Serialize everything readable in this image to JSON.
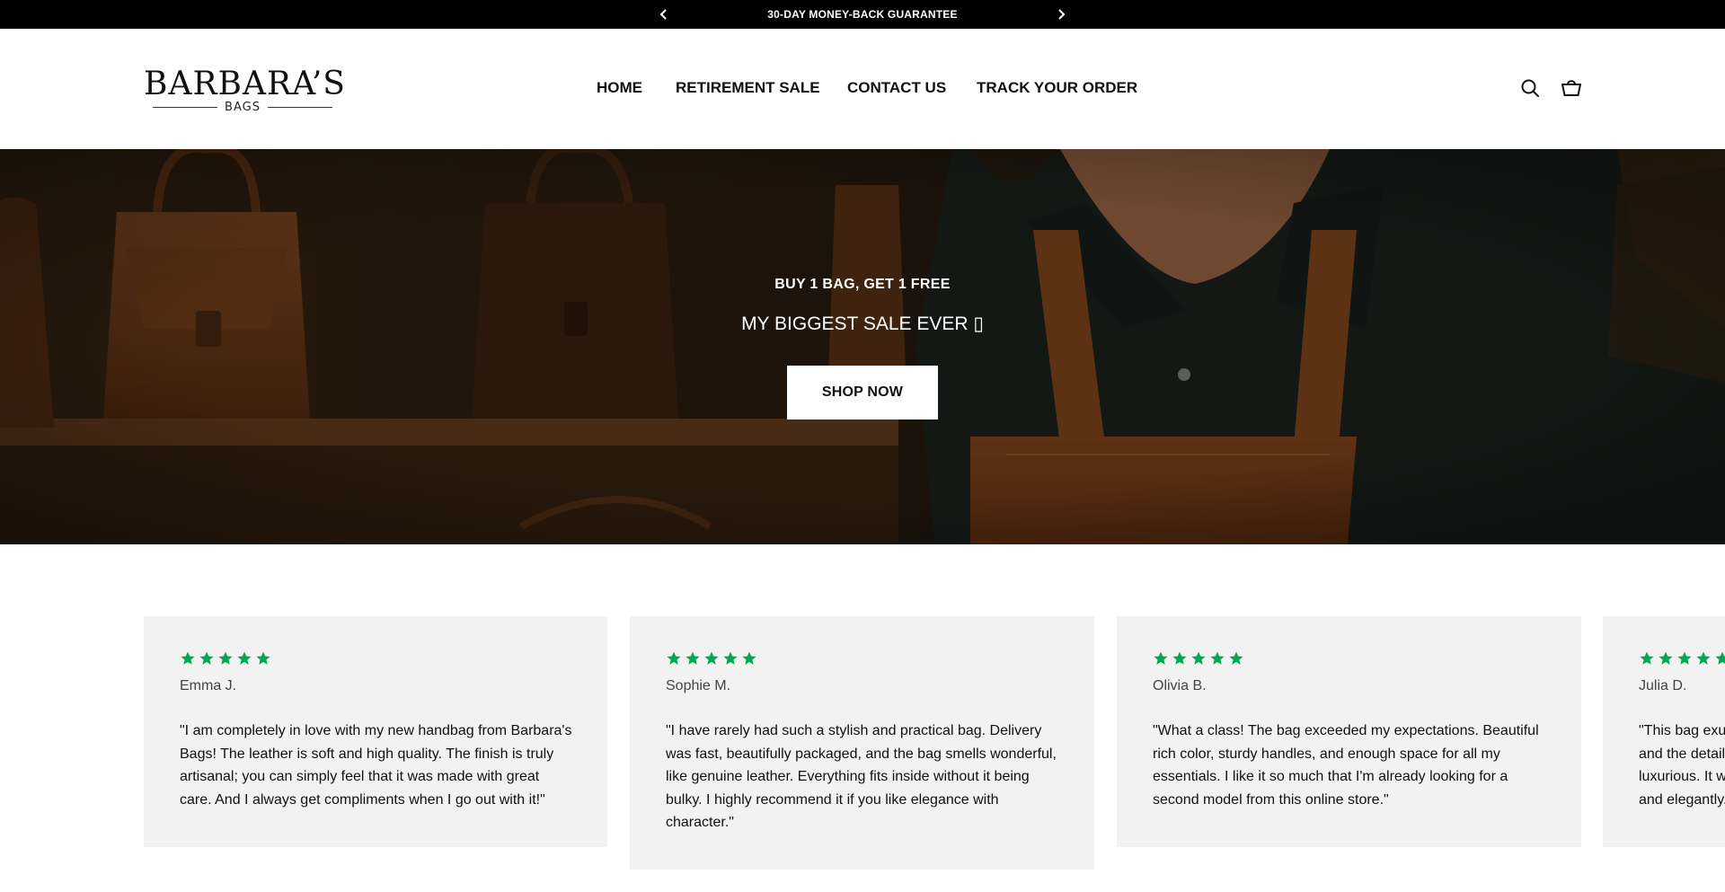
{
  "announcement": {
    "message": "30-DAY MONEY-BACK GUARANTEE",
    "prev_icon": "chevron-left-icon",
    "next_icon": "chevron-right-icon"
  },
  "header": {
    "logo_main": "BARBARA’S",
    "logo_sub": "BAGS",
    "nav": {
      "home": "HOME",
      "retirement_sale": "RETIREMENT SALE",
      "contact": "CONTACT US",
      "track": "TRACK YOUR ORDER"
    },
    "search_icon": "search-icon",
    "cart_icon": "shopping-basket-icon"
  },
  "hero": {
    "eyebrow": "BUY 1 BAG, GET 1 FREE",
    "headline": "MY BIGGEST SALE EVER ▯",
    "cta": "SHOP NOW"
  },
  "reviews": {
    "star_color": "#00a651",
    "rating": 5,
    "items": [
      {
        "name": "Emma J.",
        "text": "\"I am completely in love with my new handbag from Barbara's Bags! The leather is soft and high quality. The finish is truly artisanal; you can simply feel that it was made with great care. And I always get compliments when I go out with it!\""
      },
      {
        "name": "Sophie M.",
        "text": "\"I have rarely had such a stylish and practical bag. Delivery was fast, beautifully packaged, and the bag smells wonderful, like genuine leather. Everything fits inside without it being bulky. I highly recommend it if you like elegance with character.\""
      },
      {
        "name": "Olivia B.",
        "text": "\"What a class! The bag exceeded my expectations. Beautiful rich color, sturdy handles, and enough space for all my essentials. I like it so much that I'm already looking for a second model from this online store.\""
      },
      {
        "name": "Julia D.",
        "line1": "\"This bag exu",
        "line2": "and the detail",
        "line3": "luxurious. It w",
        "line4": "and elegantly."
      }
    ]
  }
}
